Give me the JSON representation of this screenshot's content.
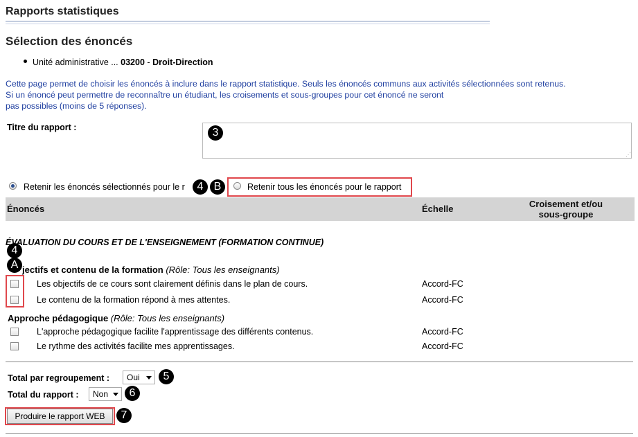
{
  "header": {
    "title": "Rapports statistiques",
    "section_title": "Sélection des énoncés"
  },
  "unit": {
    "label": "Unité administrative ...",
    "code": "03200",
    "separator": "-",
    "name": "Droit-Direction"
  },
  "intro": {
    "line1": "Cette page permet de choisir les énoncés à inclure dans le rapport statistique. Seuls les énoncés communs aux activités sélectionnées sont retenus.",
    "line2": "Si un énoncé peut permettre de reconnaître un étudiant, les croisements et sous-groupes pour cet énoncé ne seront",
    "line3": "pas possibles (moins de 5 réponses)."
  },
  "report_title": {
    "label": "Titre du rapport :",
    "value": ""
  },
  "selection_mode": {
    "option_selected": "Retenir les énoncés sélectionnés pour le r",
    "option_all": "Retenir tous les énoncés pour le rapport",
    "checked": "selected"
  },
  "table": {
    "col_enonces": "Énoncés",
    "col_echelle": "Échelle",
    "col_croisement_line1": "Croisement et/ou",
    "col_croisement_line2": "sous-groupe"
  },
  "group": {
    "title": "ÉVALUATION DU COURS ET DE L'ENSEIGNEMENT (FORMATION CONTINUE)",
    "categories": [
      {
        "name": "jectifs et contenu de la formation",
        "role": "(Rôle: Tous les enseignants)",
        "items": [
          {
            "text": "Les objectifs de ce cours sont clairement définis dans le plan de cours.",
            "scale": "Accord-FC"
          },
          {
            "text": "Le contenu de la formation répond à mes attentes.",
            "scale": "Accord-FC"
          }
        ]
      },
      {
        "name": "Approche pédagogique",
        "role": "(Rôle: Tous les enseignants)",
        "items": [
          {
            "text": "L'approche pédagogique facilite l'apprentissage des différents contenus.",
            "scale": "Accord-FC"
          },
          {
            "text": "Le rythme des activités facilite mes apprentissages.",
            "scale": "Accord-FC"
          }
        ]
      }
    ]
  },
  "totals": {
    "group_label": "Total par regroupement :",
    "group_value": "Oui",
    "report_label": "Total du rapport :",
    "report_value": "Non"
  },
  "submit": {
    "label": "Produire le rapport WEB"
  },
  "callouts": {
    "c3": "3",
    "c4a": "4",
    "cB": "B",
    "c4b": "4",
    "cA": "A",
    "c5": "5",
    "c6": "6",
    "c7": "7"
  },
  "colors": {
    "intro_text": "#1f3fa0",
    "highlight_box": "#e0474c",
    "table_header_bg": "#d4d4d4"
  }
}
